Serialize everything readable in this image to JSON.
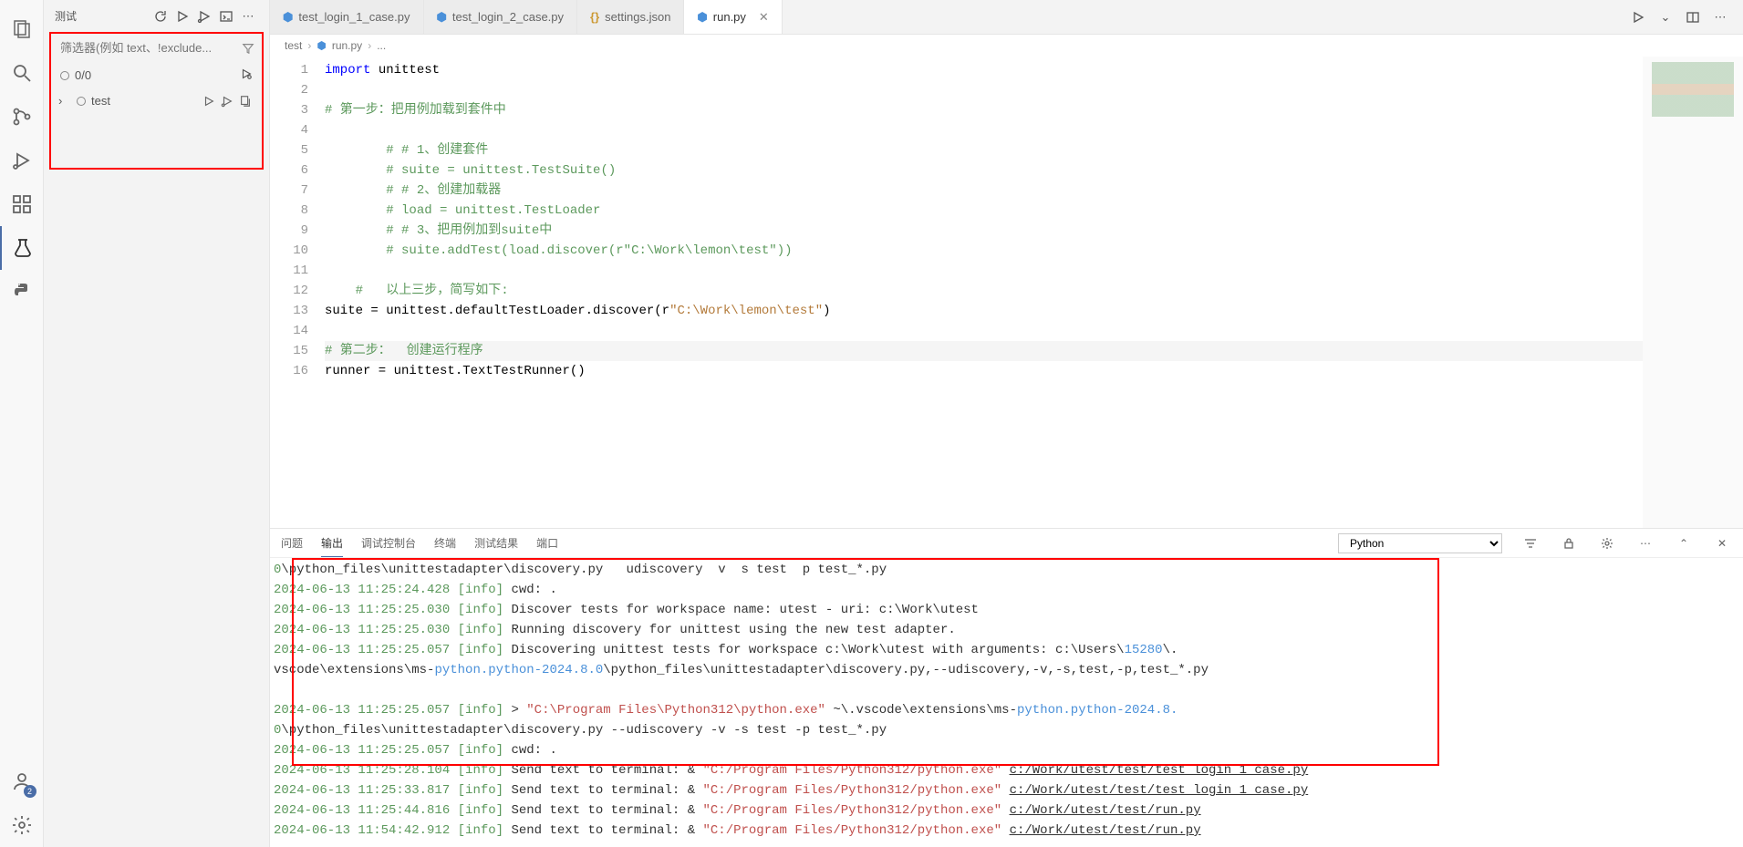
{
  "activity": {
    "account_badge": "2"
  },
  "sidebar": {
    "title": "测试",
    "filter_placeholder": "筛选器(例如 text、!exclude...",
    "count": "0/0",
    "test_item": "test"
  },
  "tabs": [
    {
      "label": "test_login_1_case.py",
      "active": false,
      "icon": "py"
    },
    {
      "label": "test_login_2_case.py",
      "active": false,
      "icon": "py"
    },
    {
      "label": "settings.json",
      "active": false,
      "icon": "json"
    },
    {
      "label": "run.py",
      "active": true,
      "icon": "py"
    }
  ],
  "breadcrumb": {
    "folder": "test",
    "file": "run.py",
    "tail": "..."
  },
  "code": {
    "lines": [
      {
        "n": 1,
        "seg": [
          [
            "kw",
            "import"
          ],
          [
            "fn",
            " unittest"
          ]
        ]
      },
      {
        "n": 2,
        "seg": []
      },
      {
        "n": 3,
        "seg": [
          [
            "com",
            "# 第一步：把用例加载到套件中"
          ]
        ]
      },
      {
        "n": 4,
        "seg": []
      },
      {
        "n": 5,
        "seg": [
          [
            "fn",
            "        "
          ],
          [
            "com",
            "# # 1、创建套件"
          ]
        ]
      },
      {
        "n": 6,
        "seg": [
          [
            "fn",
            "        "
          ],
          [
            "com",
            "# suite = unittest.TestSuite()"
          ]
        ]
      },
      {
        "n": 7,
        "seg": [
          [
            "fn",
            "        "
          ],
          [
            "com",
            "# # 2、创建加载器"
          ]
        ]
      },
      {
        "n": 8,
        "seg": [
          [
            "fn",
            "        "
          ],
          [
            "com",
            "# load = unittest.TestLoader"
          ]
        ]
      },
      {
        "n": 9,
        "seg": [
          [
            "fn",
            "        "
          ],
          [
            "com",
            "# # 3、把用例加到suite中"
          ]
        ]
      },
      {
        "n": 10,
        "seg": [
          [
            "fn",
            "        "
          ],
          [
            "com",
            "# suite.addTest(load.discover(r\"C:\\Work\\lemon\\test\"))"
          ]
        ]
      },
      {
        "n": 11,
        "seg": []
      },
      {
        "n": 12,
        "seg": [
          [
            "fn",
            "    "
          ],
          [
            "com",
            "#   以上三步，简写如下:"
          ]
        ]
      },
      {
        "n": 13,
        "seg": [
          [
            "fn",
            "suite = unittest.defaultTestLoader.discover(r"
          ],
          [
            "str",
            "\"C:\\Work\\lemon\\test\""
          ],
          [
            "fn",
            ")"
          ]
        ]
      },
      {
        "n": 14,
        "seg": []
      },
      {
        "n": 15,
        "seg": [
          [
            "com",
            "# 第二步：  创建运行程序"
          ]
        ],
        "current": true
      },
      {
        "n": 16,
        "seg": [
          [
            "fn",
            "runner = unittest.TextTestRunner()"
          ]
        ]
      }
    ]
  },
  "panel": {
    "tabs": [
      "问题",
      "输出",
      "调试控制台",
      "终端",
      "测试结果",
      "端口"
    ],
    "active": "输出",
    "dropdown": "Python"
  },
  "output": [
    [
      [
        "out-num",
        "0"
      ],
      [
        "",
        "\\python_files\\unittestadapter\\discovery.py   udiscovery  v  s test  p test_*.py"
      ]
    ],
    [
      [
        "out-ts",
        "2024-06-13 11:25:24.428"
      ],
      [
        "",
        " "
      ],
      [
        "out-info",
        "[info]"
      ],
      [
        "",
        " cwd: ."
      ]
    ],
    [
      [
        "out-ts",
        "2024-06-13 11:25:25.030"
      ],
      [
        "",
        " "
      ],
      [
        "out-info",
        "[info]"
      ],
      [
        "",
        " Discover tests for workspace name: utest - uri: c:\\Work\\utest"
      ]
    ],
    [
      [
        "out-ts",
        "2024-06-13 11:25:25.030"
      ],
      [
        "",
        " "
      ],
      [
        "out-info",
        "[info]"
      ],
      [
        "",
        " Running discovery for unittest using the new test adapter."
      ]
    ],
    [
      [
        "out-ts",
        "2024-06-13 11:25:25.057"
      ],
      [
        "",
        " "
      ],
      [
        "out-info",
        "[info]"
      ],
      [
        "",
        " Discovering unittest tests for workspace c:\\Work\\utest with arguments: c:\\Users\\"
      ],
      [
        "out-path",
        "15280"
      ],
      [
        "",
        "\\."
      ]
    ],
    [
      [
        "",
        "vscode\\extensions\\ms-"
      ],
      [
        "out-path",
        "python.python-2024.8.0"
      ],
      [
        "",
        "\\python_files\\unittestadapter\\discovery.py,--udiscovery,-v,-s,test,-p,test_*.py"
      ]
    ],
    [],
    [
      [
        "out-ts",
        "2024-06-13 11:25:25.057"
      ],
      [
        "",
        " "
      ],
      [
        "out-info",
        "[info]"
      ],
      [
        "",
        " > "
      ],
      [
        "out-str",
        "\"C:\\Program Files\\Python312\\python.exe\""
      ],
      [
        "",
        " ~\\.vscode\\extensions\\ms-"
      ],
      [
        "out-path",
        "python.python-2024.8."
      ]
    ],
    [
      [
        "out-num",
        "0"
      ],
      [
        "",
        "\\python_files\\unittestadapter\\discovery.py --udiscovery -v -s test -p test_*.py"
      ]
    ],
    [
      [
        "out-ts",
        "2024-06-13 11:25:25.057"
      ],
      [
        "",
        " "
      ],
      [
        "out-info",
        "[info]"
      ],
      [
        "",
        " cwd: ."
      ]
    ],
    [
      [
        "out-ts",
        "2024-06-13 11:25:28.104"
      ],
      [
        "",
        " "
      ],
      [
        "out-info",
        "[info]"
      ],
      [
        "",
        " Send text to terminal: & "
      ],
      [
        "out-str",
        "\"C:/Program Files/Python312/python.exe\""
      ],
      [
        "",
        " "
      ],
      [
        "out-link",
        "c:/Work/utest/test/test_login_1_case.py"
      ]
    ],
    [
      [
        "out-ts",
        "2024-06-13 11:25:33.817"
      ],
      [
        "",
        " "
      ],
      [
        "out-info",
        "[info]"
      ],
      [
        "",
        " Send text to terminal: & "
      ],
      [
        "out-str",
        "\"C:/Program Files/Python312/python.exe\""
      ],
      [
        "",
        " "
      ],
      [
        "out-link",
        "c:/Work/utest/test/test_login_1_case.py"
      ]
    ],
    [
      [
        "out-ts",
        "2024-06-13 11:25:44.816"
      ],
      [
        "",
        " "
      ],
      [
        "out-info",
        "[info]"
      ],
      [
        "",
        " Send text to terminal: & "
      ],
      [
        "out-str",
        "\"C:/Program Files/Python312/python.exe\""
      ],
      [
        "",
        " "
      ],
      [
        "out-link",
        "c:/Work/utest/test/run.py"
      ]
    ],
    [
      [
        "out-ts",
        "2024-06-13 11:54:42.912"
      ],
      [
        "",
        " "
      ],
      [
        "out-info",
        "[info]"
      ],
      [
        "",
        " Send text to terminal: & "
      ],
      [
        "out-str",
        "\"C:/Program Files/Python312/python.exe\""
      ],
      [
        "",
        " "
      ],
      [
        "out-link",
        "c:/Work/utest/test/run.py"
      ]
    ]
  ]
}
